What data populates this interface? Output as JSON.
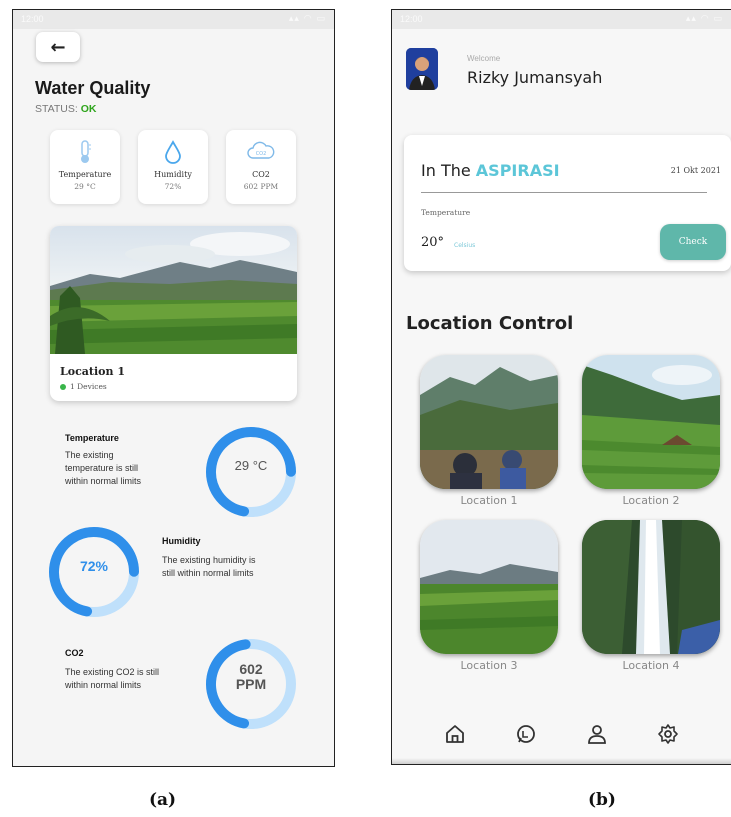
{
  "panel_a": {
    "status_time": "12:00",
    "back_arrow": "←",
    "title": "Water Quality",
    "status_label": "STATUS:",
    "status_value": "OK",
    "sensors": [
      {
        "icon": "thermometer-icon",
        "label": "Temperature",
        "value": "29 °C"
      },
      {
        "icon": "water-drop-icon",
        "label": "Humidity",
        "value": "72%"
      },
      {
        "icon": "cloud-co2-icon",
        "label": "CO2",
        "value": "602 PPM"
      }
    ],
    "location": {
      "name": "Location 1",
      "devices": "1 Devices"
    },
    "metrics": [
      {
        "title": "Temperature",
        "desc_lines": [
          "The existing",
          "temperature is still",
          "within normal limits"
        ],
        "gauge_text": "29 °C",
        "level": 0.72
      },
      {
        "title": "Humidity",
        "desc_lines": [
          "The existing humidity is",
          "still within normal limits"
        ],
        "gauge_text": "72%",
        "level": 0.72
      },
      {
        "title": "CO2",
        "desc_lines": [
          "The existing CO2 is still",
          "within normal limits"
        ],
        "gauge_text_1": "602",
        "gauge_text_2": "PPM",
        "level": 0.45
      }
    ]
  },
  "panel_b": {
    "status_time": "12:00",
    "welcome": "Welcome",
    "username": "Rizky Jumansyah",
    "place_prefix": "In The",
    "place_name": "ASPIRASI",
    "date": "21 Okt 2021",
    "temp_label": "Temperature",
    "temp_value": "20°",
    "temp_unit": "Celsius",
    "check_label": "Check",
    "section_title": "Location Control",
    "locations": [
      "Location 1",
      "Location 2",
      "Location 3",
      "Location 4"
    ],
    "nav": [
      "home-icon",
      "chat-icon",
      "profile-icon",
      "settings-icon"
    ]
  },
  "captions": {
    "a": "(a)",
    "b": "(b)"
  },
  "colors": {
    "accent_blue": "#2f8fea",
    "gauge_track": "#bfe0fb",
    "ok_green": "#2fa51c",
    "check_teal": "#5fb7aa",
    "aspirasi_cyan": "#5cc6d8"
  }
}
